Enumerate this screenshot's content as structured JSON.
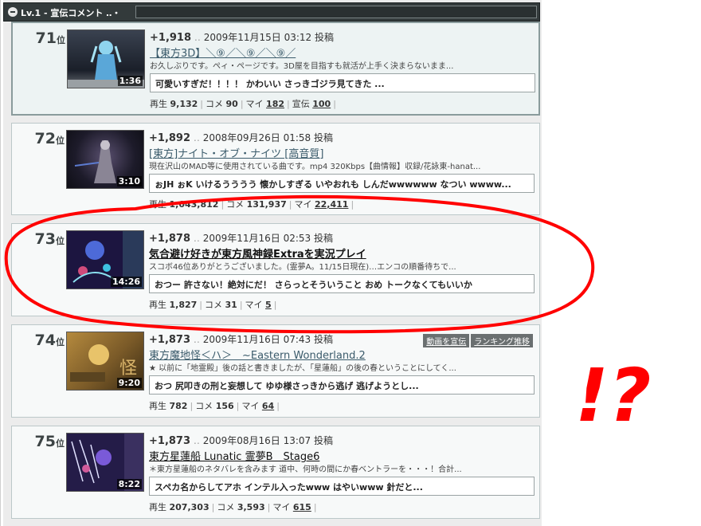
{
  "header": {
    "label": "Lv.1 - 宣伝コメント ‥・"
  },
  "stats_labels": {
    "play": "再生",
    "comment": "コメ",
    "mylist": "マイ",
    "ad": "宣伝"
  },
  "rank_suffix": "位",
  "post_suffix": "投稿",
  "entries": [
    {
      "rank": "71",
      "points": "+1,918",
      "date": "2009年11月15日",
      "time": "03:12",
      "title": "【東方3D】＼⑨／＼⑨／＼⑨／",
      "desc": "お久しぶりです。ぺィ・ぺージです。3D屋を目指すも就活が上手く決まらないまま...",
      "comment": "可愛いすぎだ！！！！ かわいい さっきゴジラ見てきた ...",
      "duration": "1:36",
      "plays": "9,132",
      "comments": "90",
      "mylist": "182",
      "ad": "100"
    },
    {
      "rank": "72",
      "points": "+1,892",
      "date": "2008年09月26日",
      "time": "01:58",
      "title": "[東方]ナイト・オブ・ナイツ [高音質]",
      "desc": "現在沢山のMAD等に使用されている曲です。mp4 320Kbps【曲情報】収録/花詠東-hanat...",
      "comment": "ぉJH ぉK いけるうううう 懐かしすぎる いやおれも しんだwwwwww なつい wwww...",
      "duration": "3:10",
      "plays": "1,043,812",
      "comments": "131,937",
      "mylist": "22,411"
    },
    {
      "rank": "73",
      "points": "+1,878",
      "date": "2009年11月16日",
      "time": "02:53",
      "title": "気合避け好きが東方風神録Extraを実況プレイ",
      "desc": "スコボ46位ありがとうございました。(霊夢A。11/15日現在)…エンコの順番待ちで...",
      "comment": "おつー 許さない！絶対にだ！ さらっとそういうこと おめ トークなくてもいいか",
      "duration": "14:26",
      "plays": "1,827",
      "comments": "31",
      "mylist": "5"
    },
    {
      "rank": "74",
      "points": "+1,873",
      "date": "2009年11月16日",
      "time": "07:43",
      "title": "東方魔地怪＜ハ＞　~Eastern Wonderland.2",
      "desc": "★ 以前に「地霊殿」後の話と書きましたが、「星蓮船」の後の春ということにしてく...",
      "comment": "おつ 尻叩きの刑と妄想して ゆゆ様さっきから逃げ 逃げようとし...",
      "duration": "9:20",
      "plays": "782",
      "comments": "156",
      "mylist": "64",
      "btn_ad": "動画を宣伝",
      "btn_rank": "ランキング推移"
    },
    {
      "rank": "75",
      "points": "+1,873",
      "date": "2009年08月16日",
      "time": "13:07",
      "title": "東方星蓮船 Lunatic 霊夢B　Stage6",
      "desc": "＊東方星蓮船のネタバレを含みます 道中、何時の間にか春ベントラーを・・・！合計...",
      "comment": "スペカ名からしてアホ インテル入ったwww はやいwww 針だと...",
      "duration": "8:22",
      "plays": "207,303",
      "comments": "3,593",
      "mylist": "615"
    }
  ],
  "annotation": {
    "text": "!?",
    "color": "#ff0000"
  },
  "colors": {
    "header_bg": "#333a3b",
    "card_bg": "#f7f9f9",
    "title_link": "#3b5b6b"
  }
}
